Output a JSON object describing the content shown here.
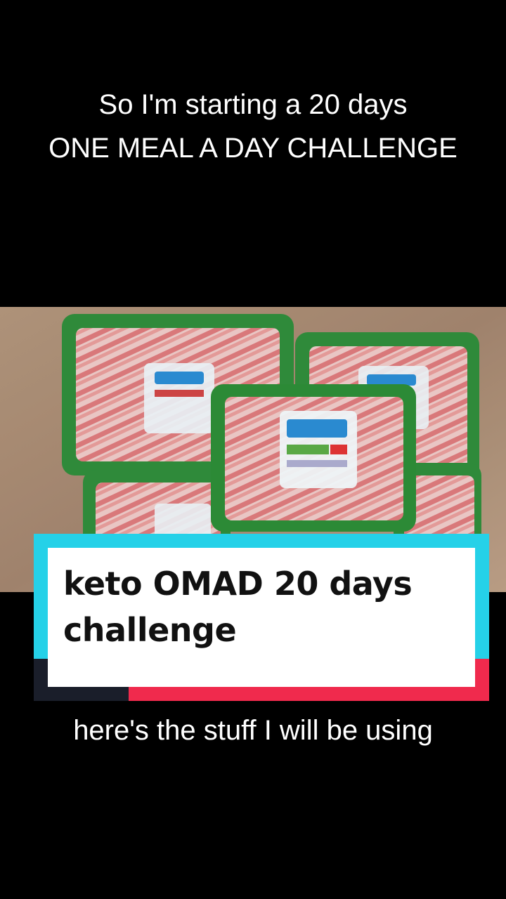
{
  "caption_top": {
    "line1": "So I'm starting a 20 days",
    "line2": "ONE MEAL A DAY CHALLENGE"
  },
  "title_card": {
    "text": "keto OMAD 20 days challenge"
  },
  "caption_bottom": {
    "text": "here's the stuff I will be using"
  },
  "colors": {
    "background": "#000000",
    "card_cyan": "#25d1e8",
    "card_red": "#f02a4d",
    "card_dark": "#1a1e2a",
    "tray_green": "#2f8a3a"
  }
}
